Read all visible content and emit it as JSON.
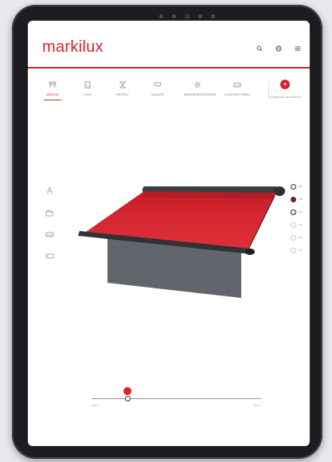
{
  "brand": {
    "logo_text": "markilux",
    "accent": "#d8232a"
  },
  "header": {
    "icons": [
      "search-icon",
      "globe-icon",
      "menu-icon"
    ]
  },
  "tabs": [
    {
      "label": "MARKISE",
      "icon": "awning-icon",
      "active": true
    },
    {
      "label": "TUCH",
      "icon": "fabric-icon",
      "active": false
    },
    {
      "label": "GESTELL",
      "icon": "frame-icon",
      "active": false
    },
    {
      "label": "VOLANTE",
      "icon": "valance-icon",
      "active": false
    },
    {
      "label": "MARKISENSTEUERUNG",
      "icon": "control-icon",
      "active": false
    },
    {
      "label": "ZUSATZOPTIONEN",
      "icon": "options-icon",
      "active": false
    }
  ],
  "configurator": {
    "label": "Konfiguration abschließen",
    "icon": "download-icon"
  },
  "side_tools": [
    "person-icon",
    "view-front-icon",
    "view-side-icon",
    "view-top-icon"
  ],
  "color_options": [
    {
      "label": "300",
      "color": "#2a2a2a",
      "selected": false
    },
    {
      "label": "330",
      "color": "#8b1d22",
      "selected": true
    },
    {
      "label": "340",
      "color": "#1a1a1a",
      "selected": false
    },
    {
      "label": "110",
      "color": "#d0d0d0",
      "selected": false
    },
    {
      "label": "120",
      "color": "#d0d0d0",
      "selected": false
    },
    {
      "label": "130",
      "color": "#d0d0d0",
      "selected": false
    }
  ],
  "slider": {
    "min_label": "180 cm",
    "max_label": "700 cm",
    "value_fraction": 0.2
  }
}
